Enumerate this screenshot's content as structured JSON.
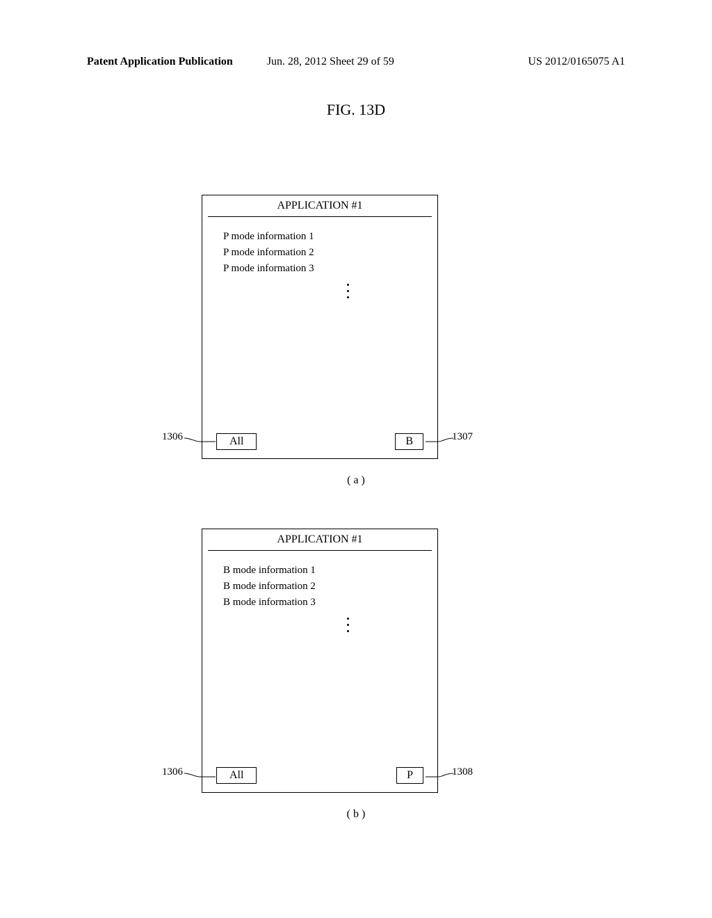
{
  "header": {
    "left": "Patent Application Publication",
    "center": "Jun. 28, 2012  Sheet 29 of 59",
    "right": "US 2012/0165075 A1"
  },
  "figureTitle": "FIG. 13D",
  "panelA": {
    "title": "APPLICATION #1",
    "items": [
      "P mode information 1",
      "P mode information 2",
      "P mode information 3"
    ],
    "leftButton": "All",
    "rightButton": "B",
    "leftRef": "1306",
    "rightRef": "1307",
    "subLabel": "( a )"
  },
  "panelB": {
    "title": "APPLICATION #1",
    "items": [
      "B mode information 1",
      "B mode information 2",
      "B mode information 3"
    ],
    "leftButton": "All",
    "rightButton": "P",
    "leftRef": "1306",
    "rightRef": "1308",
    "subLabel": "( b )"
  }
}
